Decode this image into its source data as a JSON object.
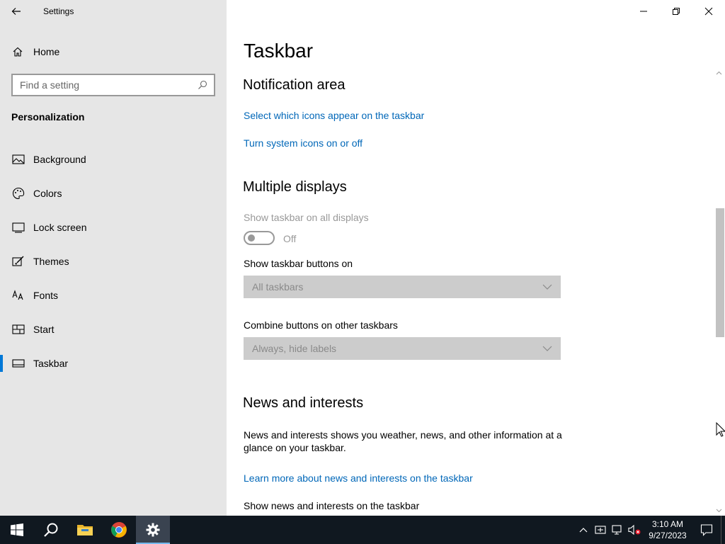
{
  "app": {
    "title": "Settings",
    "back_icon": "arrow-left-icon"
  },
  "sidebar": {
    "home_label": "Home",
    "search_placeholder": "Find a setting",
    "section_title": "Personalization",
    "items": [
      {
        "label": "Background",
        "icon": "image-icon"
      },
      {
        "label": "Colors",
        "icon": "palette-icon"
      },
      {
        "label": "Lock screen",
        "icon": "monitor-icon"
      },
      {
        "label": "Themes",
        "icon": "brush-icon"
      },
      {
        "label": "Fonts",
        "icon": "font-icon"
      },
      {
        "label": "Start",
        "icon": "grid-icon"
      },
      {
        "label": "Taskbar",
        "icon": "taskbar-icon",
        "active": true
      }
    ]
  },
  "main": {
    "page_title": "Taskbar",
    "notification_area": {
      "heading": "Notification area",
      "link1": "Select which icons appear on the taskbar",
      "link2": "Turn system icons on or off"
    },
    "multiple_displays": {
      "heading": "Multiple displays",
      "show_all_label": "Show taskbar on all displays",
      "toggle_state": "Off",
      "buttons_on_label": "Show taskbar buttons on",
      "buttons_on_value": "All taskbars",
      "combine_label": "Combine buttons on other taskbars",
      "combine_value": "Always, hide labels"
    },
    "news": {
      "heading": "News and interests",
      "description": "News and interests shows you weather, news, and other information at a glance on your taskbar.",
      "learn_more": "Learn more about news and interests on the taskbar",
      "show_label": "Show news and interests on the taskbar"
    }
  },
  "taskbar": {
    "apps": [
      "start-icon",
      "search-icon",
      "file-explorer-icon",
      "chrome-icon",
      "settings-icon"
    ],
    "clock_time": "3:10 AM",
    "clock_date": "9/27/2023"
  },
  "colors": {
    "accent": "#0078d7",
    "link": "#0067b8",
    "sidebar_bg": "#e6e6e6",
    "taskbar_bg": "#101820"
  }
}
